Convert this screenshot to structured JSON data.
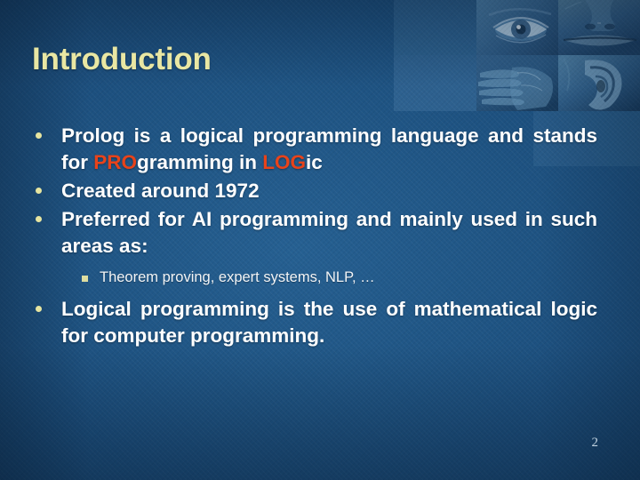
{
  "slide": {
    "title": "Introduction",
    "page_number": "2",
    "colors": {
      "background": "#1a4b79",
      "title": "#e9e7a3",
      "body_text": "#ffffff",
      "highlight": "#e8431a",
      "bullet_marker": "#e7e5a0"
    }
  },
  "content": {
    "bullets": [
      {
        "marker": "round-dot",
        "parts": [
          {
            "text": "Prolog is a logical programming language and stands for ",
            "style": "normal"
          },
          {
            "text": "PRO",
            "style": "highlight"
          },
          {
            "text": "gramming in ",
            "style": "normal"
          },
          {
            "text": "LOG",
            "style": "highlight"
          },
          {
            "text": "ic",
            "style": "normal"
          }
        ],
        "plain": "Prolog is a logical programming language and stands for PROgramming in LOGic"
      },
      {
        "marker": "round-dot",
        "plain": "Created around 1972"
      },
      {
        "marker": "round-dot",
        "plain": "Preferred for AI programming and mainly used in such areas as:"
      },
      {
        "marker": "round-dot",
        "plain": "Logical programming is the use of mathematical logic for computer programming."
      }
    ],
    "sub_bullets": [
      {
        "marker": "square",
        "text": "Theorem proving, expert systems, NLP, …"
      }
    ]
  },
  "decor": {
    "strip_label": "senses-photo-grid",
    "cells": [
      {
        "name": "tint-block-empty-1",
        "kind": "tint"
      },
      {
        "name": "photo-eye",
        "kind": "photo"
      },
      {
        "name": "photo-nose-lips",
        "kind": "photo"
      },
      {
        "name": "tint-block-empty-2",
        "kind": "tint"
      },
      {
        "name": "photo-hand",
        "kind": "photo"
      },
      {
        "name": "photo-ear",
        "kind": "photo"
      }
    ]
  }
}
